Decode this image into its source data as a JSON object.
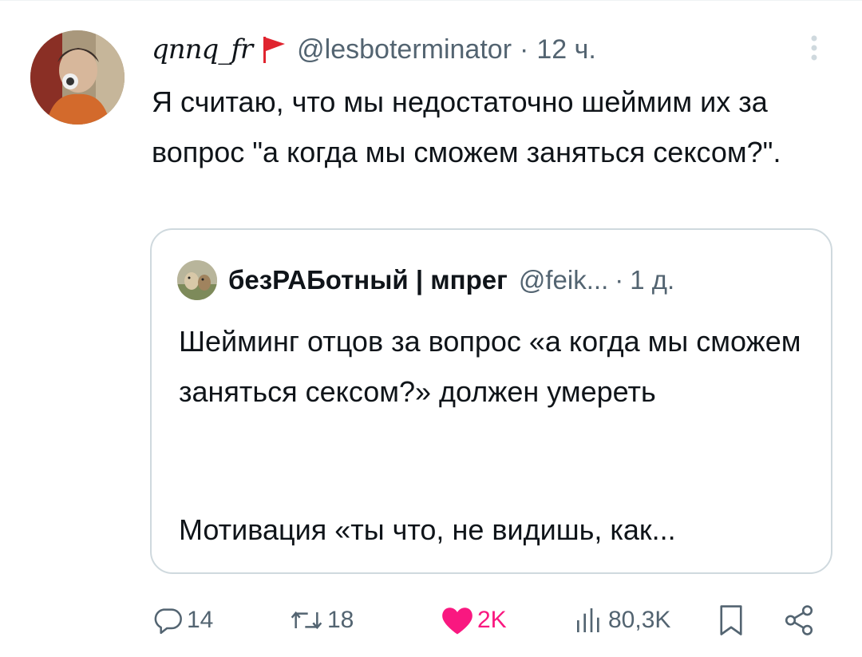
{
  "tweet": {
    "display_name": "qnnq_fr",
    "handle": "@lesboterminator",
    "separator": "·",
    "time": "12 ч.",
    "text": "Я считаю, что мы недостаточно шеймим их за вопрос \"а когда мы сможем заняться сексом?\"."
  },
  "quote": {
    "display_name": "безРАБотный | мпрег",
    "handle": "@feik...",
    "separator": "·",
    "time": "1 д.",
    "text": "Шейминг отцов за вопрос «а когда мы сможем заняться сексом?» должен умереть",
    "text2": "Мотивация «ты что, не видишь, как..."
  },
  "actions": {
    "replies": "14",
    "retweets": "18",
    "likes": "2K",
    "views": "80,3K"
  },
  "icons": {
    "flag": "red-flag-icon",
    "more": "more-vertical-icon",
    "reply": "reply-icon",
    "retweet": "retweet-icon",
    "like": "heart-icon",
    "views": "views-icon",
    "bookmark": "bookmark-icon",
    "share": "share-icon"
  },
  "colors": {
    "secondary_text": "#536471",
    "like": "#f91880",
    "flag": "#e0242f",
    "border": "#cfd9de"
  }
}
